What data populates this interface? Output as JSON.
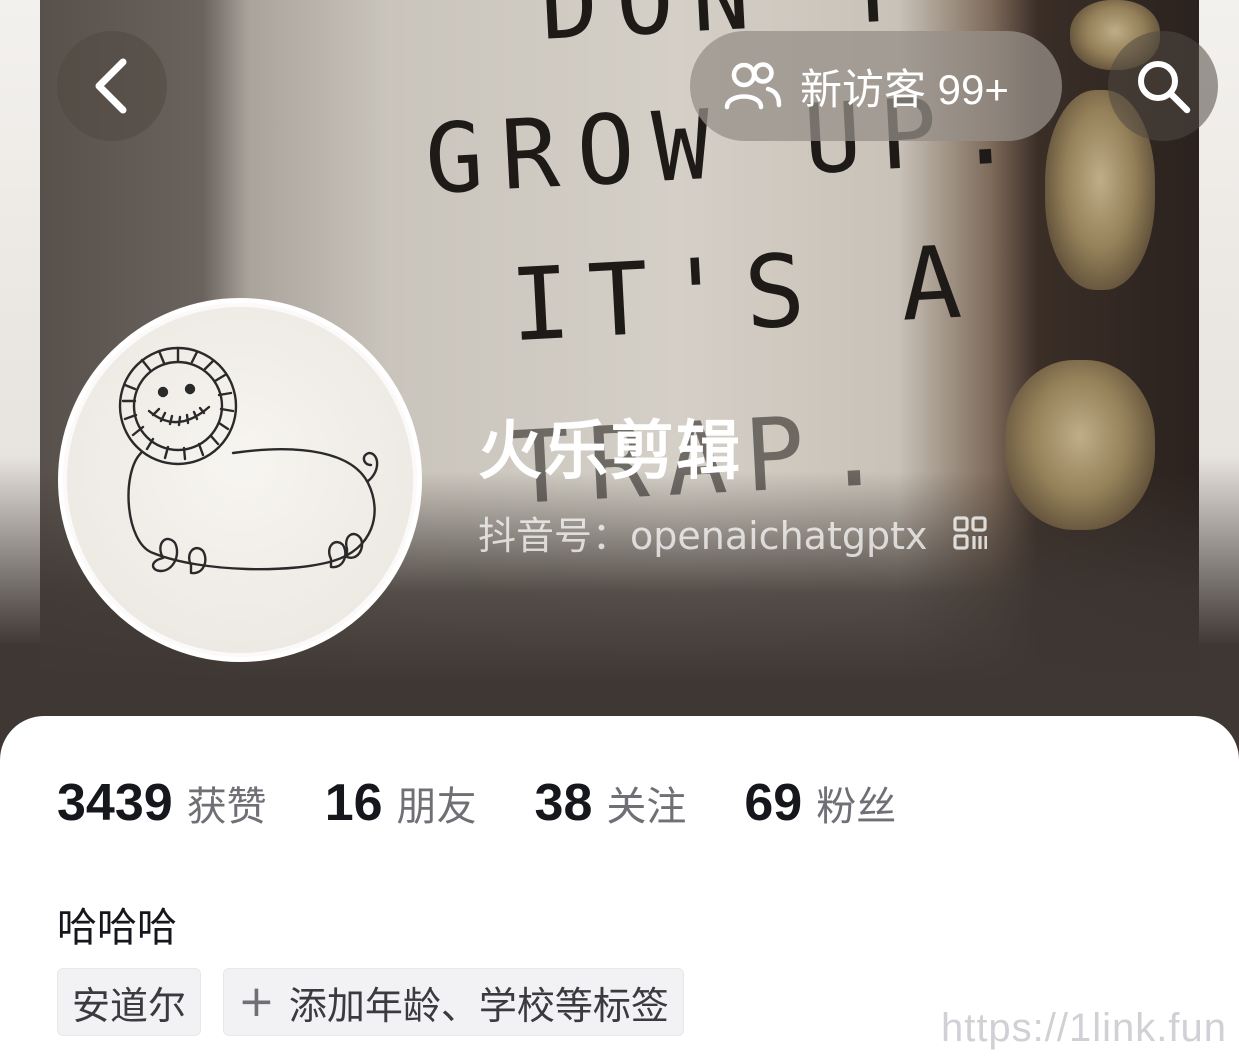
{
  "header": {
    "visitors_label": "新访客 99+",
    "icons": {
      "back": "chevron-left-icon",
      "visitors": "people-icon",
      "search": "search-icon",
      "qr": "qr-code-icon"
    }
  },
  "cover": {
    "sign_lines": [
      "DON'T",
      "GROW UP.",
      "IT'S A",
      "TRAP."
    ]
  },
  "profile": {
    "name": "火乐剪辑",
    "account_id": "抖音号：openaichatgptx"
  },
  "stats": [
    {
      "value": "3439",
      "label": "获赞"
    },
    {
      "value": "16",
      "label": "朋友"
    },
    {
      "value": "38",
      "label": "关注"
    },
    {
      "value": "69",
      "label": "粉丝"
    }
  ],
  "bio": "哈哈哈",
  "tags": {
    "location": "安道尔",
    "add_label": "添加年龄、学校等标签"
  },
  "watermark": "https://1link.fun",
  "colors": {
    "cover_bg": "#3e3733",
    "text_primary": "#16161d",
    "text_secondary": "#6f6f76",
    "tag_bg": "#f2f2f4"
  }
}
